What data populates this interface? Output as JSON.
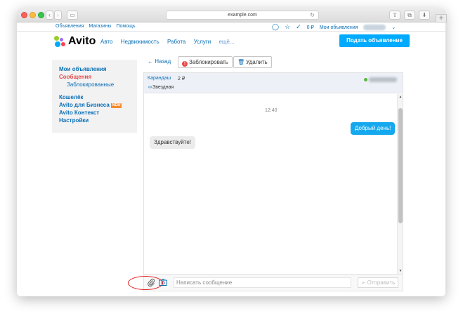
{
  "browser": {
    "url": "example.com",
    "new_tab": "+"
  },
  "top_nav": {
    "links": [
      "Объявления",
      "Магазины",
      "Помощь"
    ],
    "wallet": "0 ₽",
    "my_ads": "Мои объявления",
    "username_blurred": "Игорь"
  },
  "header": {
    "logo": "Avito",
    "categories": [
      "Авто",
      "Недвижимость",
      "Работа",
      "Услуги",
      "ещё..."
    ],
    "post_ad": "Подать объявление"
  },
  "sidebar": {
    "my_ads": "Мои объявления",
    "messages": "Сообщения",
    "blocked": "Заблокированные",
    "wallet": "Кошелёк",
    "business": "Avito для Бизнеса",
    "new_badge": "NEW",
    "context": "Avito Контекст",
    "settings": "Настройки"
  },
  "toolbar": {
    "back": "← Назад",
    "block": "Заблокировать",
    "delete": "Удалить"
  },
  "chat": {
    "item_title": "Карандаш",
    "item_price": "2 ₽",
    "user_name": "Звездная",
    "time": "12:40",
    "outgoing": "Добрый день!",
    "incoming": "Здравствуйте!",
    "input_placeholder": "Написать сообщение",
    "send": "Отправить"
  },
  "colors": {
    "accent": "#00aaff",
    "link": "#0a6fb5",
    "active_red": "#e84a4a",
    "outgoing_bubble": "#14a8ee",
    "highlight_ring": "#e02020"
  }
}
